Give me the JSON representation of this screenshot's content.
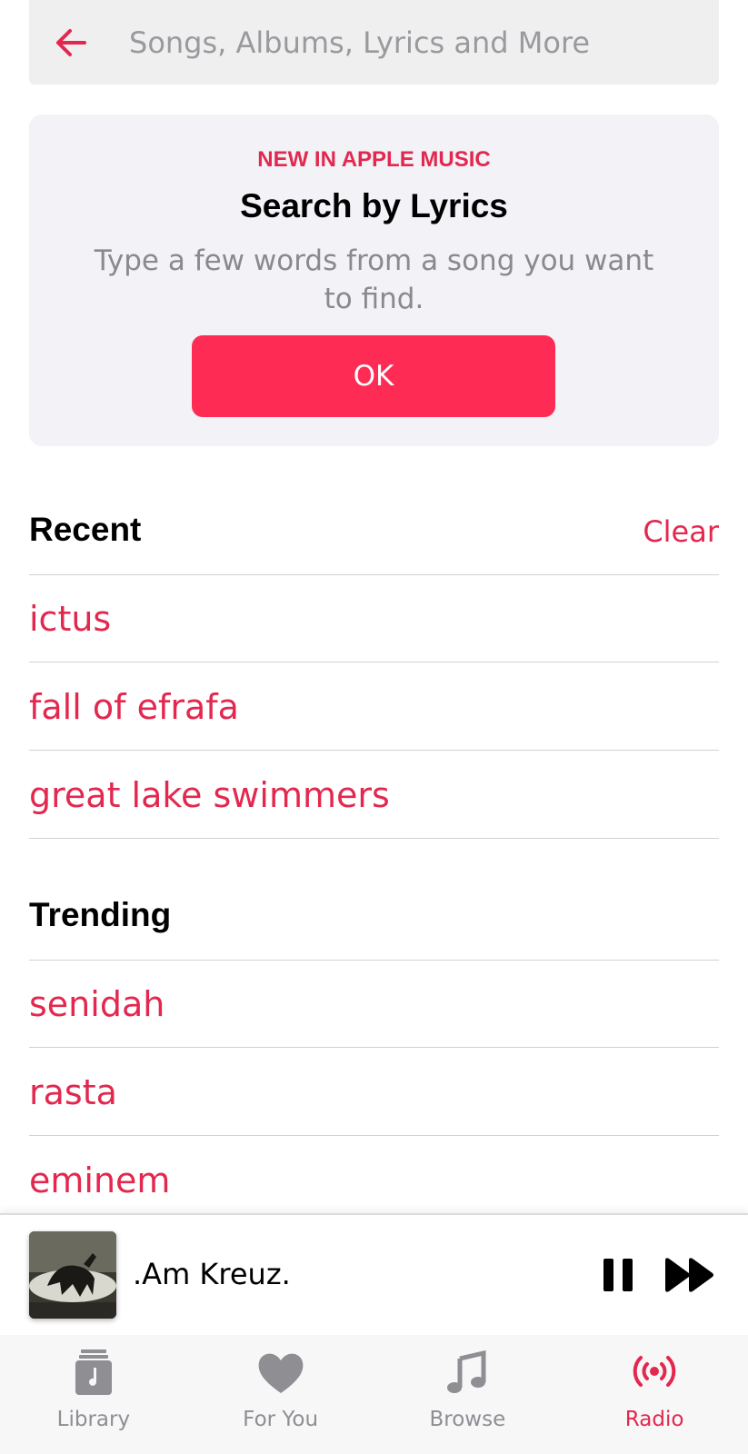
{
  "search": {
    "placeholder": "Songs, Albums, Lyrics and More",
    "back_icon": "back-arrow-icon"
  },
  "promo": {
    "eyebrow": "NEW IN APPLE MUSIC",
    "title": "Search by Lyrics",
    "description": "Type a few words from a song you want to find.",
    "ok_label": "OK"
  },
  "recent": {
    "title": "Recent",
    "clear_label": "Clear",
    "items": [
      "ictus",
      "fall of efrafa",
      "great lake swimmers"
    ]
  },
  "trending": {
    "title": "Trending",
    "items": [
      "senidah",
      "rasta",
      "eminem"
    ]
  },
  "player": {
    "track_title": ".Am Kreuz.",
    "pause_icon": "pause-icon",
    "next_icon": "fast-forward-icon"
  },
  "tabs": [
    {
      "label": "Library",
      "icon": "library-icon",
      "active": false
    },
    {
      "label": "For You",
      "icon": "heart-icon",
      "active": false
    },
    {
      "label": "Browse",
      "icon": "music-note-icon",
      "active": false
    },
    {
      "label": "Radio",
      "icon": "radio-broadcast-icon",
      "active": true
    }
  ],
  "colors": {
    "accent": "#e3284f",
    "button": "#fe2c55",
    "inactive_tab": "#8e8e93"
  }
}
